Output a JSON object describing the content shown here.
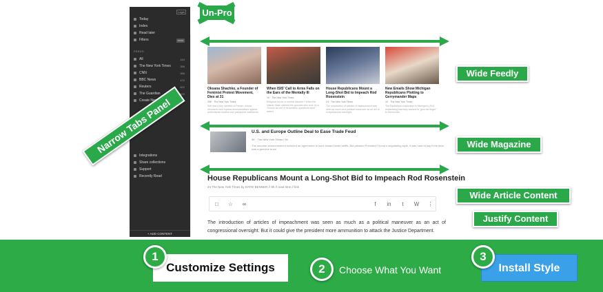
{
  "sidebar": {
    "login_label": "Login",
    "nav": [
      {
        "label": "Today"
      },
      {
        "label": "Index"
      },
      {
        "label": "Read later"
      },
      {
        "label": "Filters",
        "badge": "more"
      }
    ],
    "feeds_heading": "FEEDS",
    "feeds": [
      {
        "label": "All",
        "count": "164"
      },
      {
        "label": "The New York Times",
        "count": "356"
      },
      {
        "label": "CNN",
        "count": "356"
      },
      {
        "label": "BBC News",
        "count": "470"
      },
      {
        "label": "Reuters",
        "count": "822"
      },
      {
        "label": "The Guardian",
        "count": "800"
      },
      {
        "label": "Create New Feed",
        "count": ""
      }
    ],
    "extras": [
      {
        "label": "Integrations"
      },
      {
        "label": "Share collections"
      },
      {
        "label": "Support"
      },
      {
        "label": "Recently Read"
      }
    ],
    "add_content": "+ ADD CONTENT"
  },
  "cards": [
    {
      "title": "Oksana Shachko, a Founder of Feminist Protest Movement, Dies at 31",
      "meta": "25K · The New York Times",
      "excerpt": "She was a key member of Femen, whose members used topless demonstrations against authoritarian leaders and patriarchal institutions."
    },
    {
      "title": "When ISIS' Call to Arms Falls on the Ears of the Mentally Ill",
      "meta": "1K · The New York Times",
      "excerpt": "Religious fervor or mental disorder? When the Islamic State claimed the gunman who shot 14 in Toronto as one of its soldiers, questions were raised."
    },
    {
      "title": "House Republicans Mount a Long-Shot Bid to Impeach Rod Rosenstein",
      "meta": "24 · The New York Times",
      "excerpt": "The introduction of articles of impeachment was seen as much as a political maneuver as an act of congressional oversight."
    },
    {
      "title": "New Emails Show Michigan Republicans Plotting to Gerrymander Maps",
      "meta": "1K · The New York Times",
      "excerpt": "The Republican mapmaker in Michigan's 2011 redistricting said they wanted to \"give the finger\" to Democrats."
    }
  ],
  "magazine": {
    "title": "U.S. and Europe Outline Deal to Ease Trade Feud",
    "meta": "3K · The New York Times / 9h",
    "excerpt": "The surprise announcement included an agreement to work toward lower tariffs. But pleased President Trump's negotiating style, it was hard to say if the deal was a genuine truce."
  },
  "article": {
    "title": "House Republicans Mount a Long-Shot Bid to Impeach Rod Rosenstein",
    "meta": "24 The New York Times by KATIE BENNER // 9h // read time // link",
    "body": "The introduction of articles of impeachment was seen as much as a political maneuver as an act of congressional oversight. But it could give the president more ammunition to attack the Justice Department."
  },
  "labels": {
    "unpro": "Un-Pro",
    "wide_feedly": "Wide Feedly",
    "wide_magazine": "Wide Magazine",
    "wide_article": "Wide Article Content",
    "justify": "Justify Content",
    "narrow_tabs": "Narrow Tabs Panel"
  },
  "steps": {
    "one_num": "1",
    "one_label": "Customize Settings",
    "two_num": "2",
    "two_label": "Choose What You Want",
    "three_num": "3",
    "three_label": "Install Style"
  },
  "colors": {
    "accent_green": "#2aa84a",
    "install_blue": "#3aa0e8",
    "sidebar_dark": "#2b2b2b"
  }
}
